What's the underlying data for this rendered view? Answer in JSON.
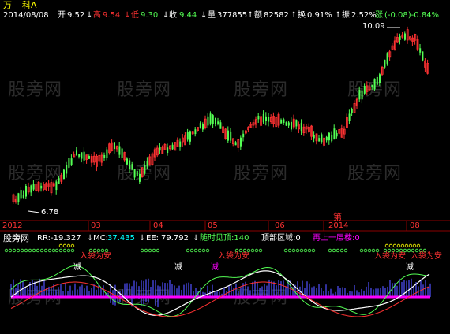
{
  "watermark": "股旁网",
  "title_chars": {
    "a": "万",
    "b": "科A"
  },
  "header": {
    "date": "2014/08/08",
    "open_label": "开",
    "open": "9.52",
    "high_label": "高",
    "high": "9.54",
    "low_label": "低",
    "low": "9.30",
    "close_label": "收",
    "close": "9.44",
    "volume_label": "量",
    "volume": "377855",
    "amount_label": "额",
    "amount": "82582",
    "turnover_label": "换",
    "turnover": "0.91%",
    "amplitude_label": "振",
    "amplitude": "2.52%",
    "change_label": "涨",
    "change": "(-0.08)-0.84%"
  },
  "price_labels": {
    "high_marker": "10.09",
    "low_marker": "6.78"
  },
  "time_axis": [
    "2012",
    "03",
    "04",
    "05",
    "06",
    "2014",
    "08"
  ],
  "red_marker": "第",
  "indicator": {
    "name": "股旁网",
    "rr_label": "RR:",
    "rr": "-19.327",
    "mc_label": "MC:",
    "mc": "37.435",
    "ee_label": "EE:",
    "ee": "79.792",
    "sell_any_time": "随时见顶:140",
    "top_zone": "顶部区域:0",
    "next_level": "再上一层楼:0"
  },
  "signals": {
    "buy": "入袋为安",
    "reduce": "减"
  },
  "colors": {
    "up": "#ff3232",
    "down": "#54ff54",
    "white": "#ffffff",
    "yellow": "#ffff00",
    "cyan": "#00ffff",
    "magenta": "#ff00ff",
    "blue": "#5050ff",
    "gridred": "#8b0000"
  }
}
